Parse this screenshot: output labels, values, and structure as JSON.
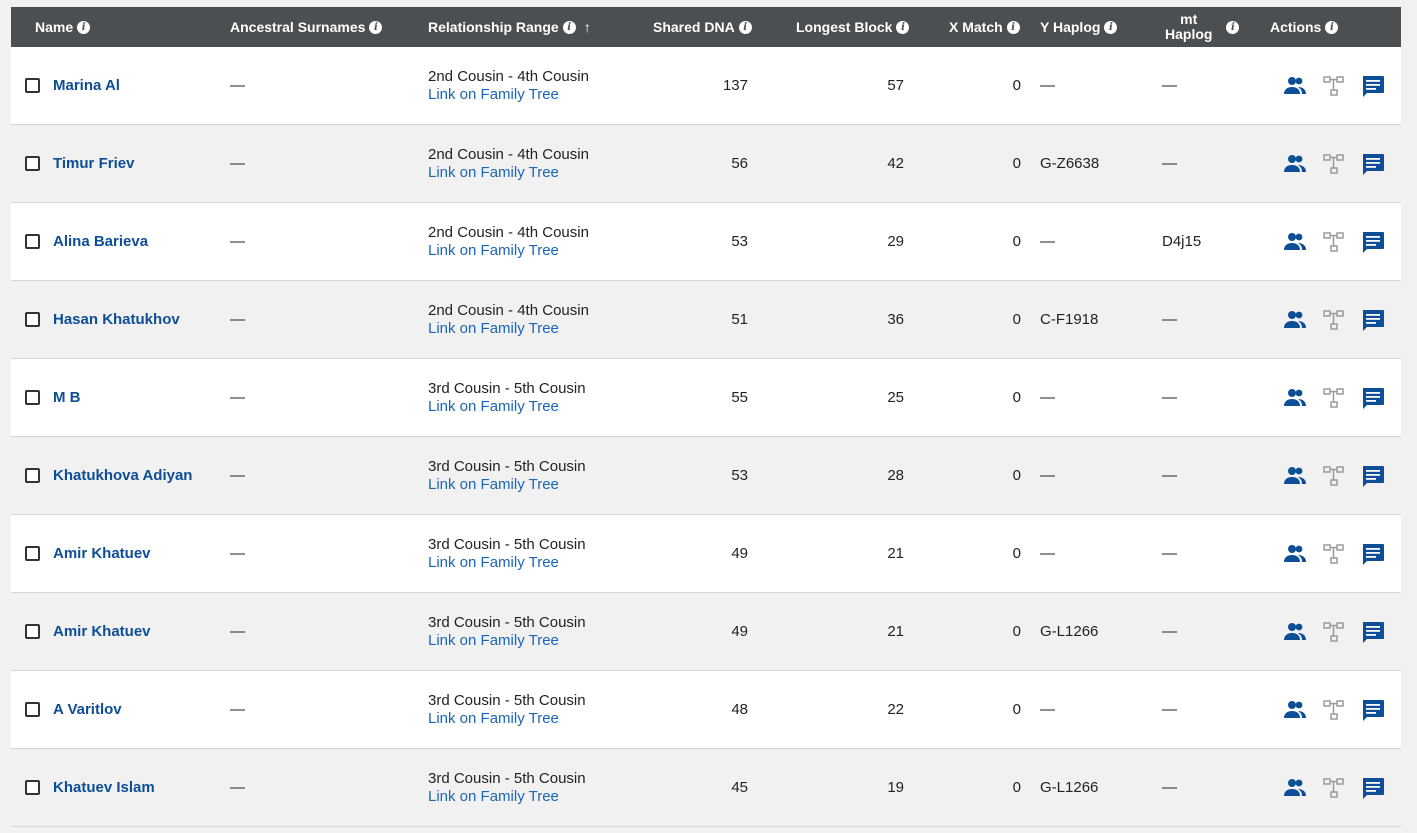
{
  "header": {
    "name": "Name",
    "ancestral_surnames": "Ancestral Surnames",
    "relationship_range": "Relationship Range",
    "sort_arrow": "↑",
    "shared_dna": "Shared DNA",
    "longest_block": "Longest Block",
    "x_match": "X Match",
    "y_haplog": "Y Haplog",
    "mt_haplog_line1": "mt",
    "mt_haplog_line2": "Haplog",
    "actions": "Actions",
    "info_glyph": "i"
  },
  "icons": {
    "people": "people-icon",
    "tree": "family-tree-icon",
    "message": "message-icon"
  },
  "colors": {
    "header_bg": "#4b4f51",
    "name_link": "#0d4e96",
    "tree_link": "#1a66b8",
    "action_icon": "#0d4e96",
    "tree_icon": "#9a9a9a"
  },
  "rows": [
    {
      "name": "Marina Al",
      "surnames": "—",
      "relationship": "2nd Cousin - 4th Cousin",
      "tree_link": "Link on Family Tree",
      "shared_dna": "137",
      "longest_block": "57",
      "x_match": "0",
      "y_haplog": "—",
      "mt_haplog": "—"
    },
    {
      "name": "Timur Friev",
      "surnames": "—",
      "relationship": "2nd Cousin - 4th Cousin",
      "tree_link": "Link on Family Tree",
      "shared_dna": "56",
      "longest_block": "42",
      "x_match": "0",
      "y_haplog": "G-Z6638",
      "mt_haplog": "—"
    },
    {
      "name": "Alina Barieva",
      "surnames": "—",
      "relationship": "2nd Cousin - 4th Cousin",
      "tree_link": "Link on Family Tree",
      "shared_dna": "53",
      "longest_block": "29",
      "x_match": "0",
      "y_haplog": "—",
      "mt_haplog": "D4j15"
    },
    {
      "name": "Hasan Khatukhov",
      "surnames": "—",
      "relationship": "2nd Cousin - 4th Cousin",
      "tree_link": "Link on Family Tree",
      "shared_dna": "51",
      "longest_block": "36",
      "x_match": "0",
      "y_haplog": "C-F1918",
      "mt_haplog": "—"
    },
    {
      "name": "M B",
      "surnames": "—",
      "relationship": "3rd Cousin - 5th Cousin",
      "tree_link": "Link on Family Tree",
      "shared_dna": "55",
      "longest_block": "25",
      "x_match": "0",
      "y_haplog": "—",
      "mt_haplog": "—"
    },
    {
      "name": "Khatukhova Adiyan",
      "surnames": "—",
      "relationship": "3rd Cousin - 5th Cousin",
      "tree_link": "Link on Family Tree",
      "shared_dna": "53",
      "longest_block": "28",
      "x_match": "0",
      "y_haplog": "—",
      "mt_haplog": "—"
    },
    {
      "name": "Amir Khatuev",
      "surnames": "—",
      "relationship": "3rd Cousin - 5th Cousin",
      "tree_link": "Link on Family Tree",
      "shared_dna": "49",
      "longest_block": "21",
      "x_match": "0",
      "y_haplog": "—",
      "mt_haplog": "—"
    },
    {
      "name": "Amir Khatuev",
      "surnames": "—",
      "relationship": "3rd Cousin - 5th Cousin",
      "tree_link": "Link on Family Tree",
      "shared_dna": "49",
      "longest_block": "21",
      "x_match": "0",
      "y_haplog": "G-L1266",
      "mt_haplog": "—"
    },
    {
      "name": "A Varitlov",
      "surnames": "—",
      "relationship": "3rd Cousin - 5th Cousin",
      "tree_link": "Link on Family Tree",
      "shared_dna": "48",
      "longest_block": "22",
      "x_match": "0",
      "y_haplog": "—",
      "mt_haplog": "—"
    },
    {
      "name": "Khatuev Islam",
      "surnames": "—",
      "relationship": "3rd Cousin - 5th Cousin",
      "tree_link": "Link on Family Tree",
      "shared_dna": "45",
      "longest_block": "19",
      "x_match": "0",
      "y_haplog": "G-L1266",
      "mt_haplog": "—"
    }
  ]
}
